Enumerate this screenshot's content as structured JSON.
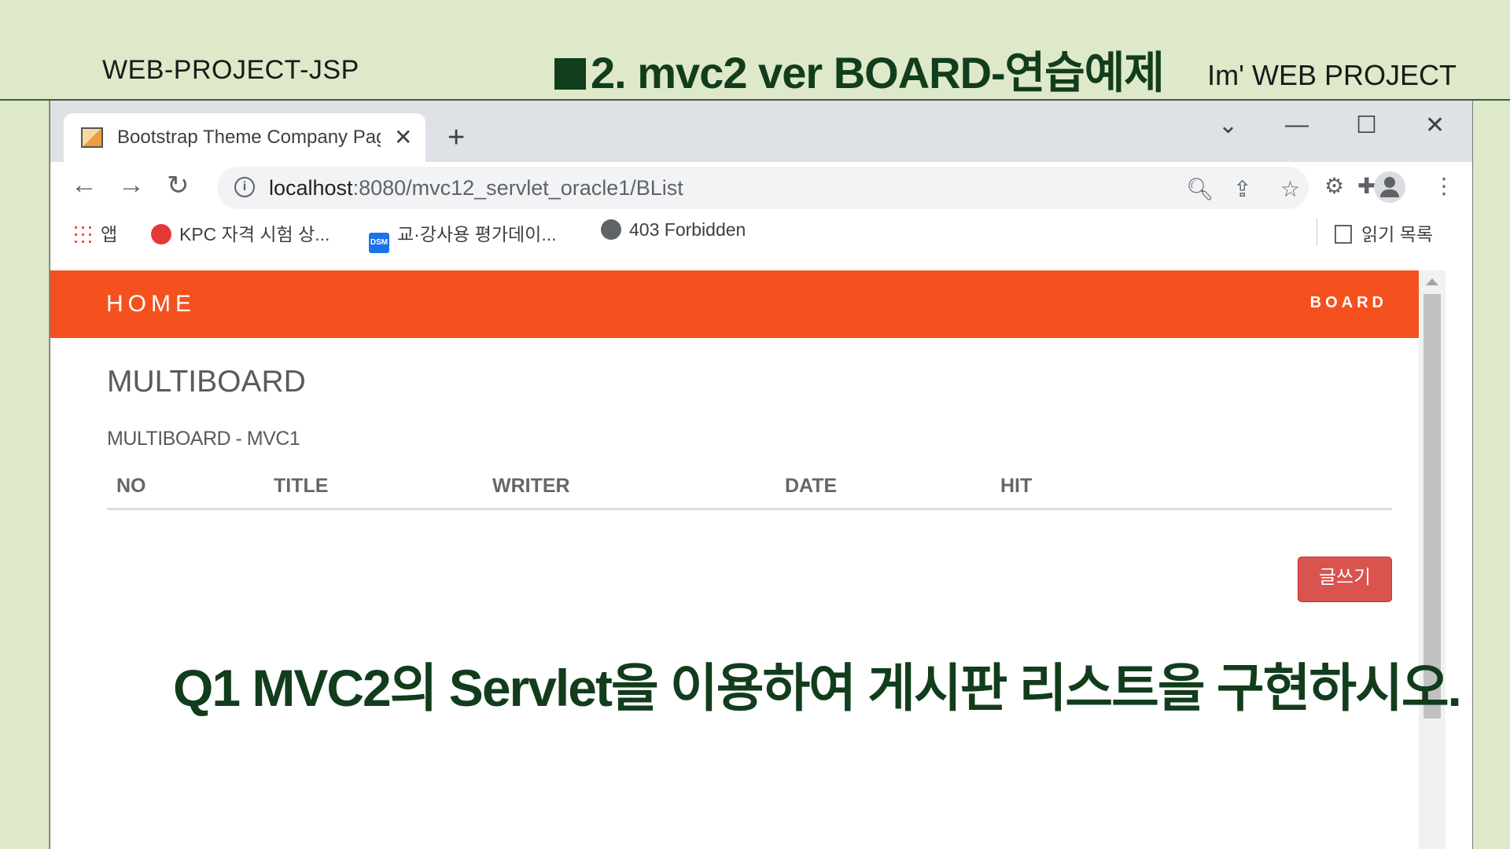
{
  "slide": {
    "left_label": "WEB-PROJECT-JSP",
    "title": "2. mvc2 ver  BOARD-연습예제",
    "right_label": "Im'  WEB PROJECT",
    "question": "Q1  MVC2의 Servlet을 이용하여 게시판 리스트을 구현하시오."
  },
  "browser": {
    "tab_title": "Bootstrap Theme Company Page",
    "tab_close": "✕",
    "new_tab": "+",
    "window_controls": [
      "⌄",
      "—",
      "☐",
      "✕"
    ],
    "nav": {
      "back": "←",
      "forward": "→",
      "reload": "↻"
    },
    "url_host": "localhost",
    "url_rest": ":8080/mvc12_servlet_oracle1/BList",
    "omnibox_icons": [
      "zoom-icon",
      "share-icon",
      "bookmark-star-icon"
    ],
    "bookmarks": [
      {
        "label": "앱",
        "icon": "apps-icon"
      },
      {
        "label": "KPC 자격 시험 상...",
        "icon": "kpc-icon"
      },
      {
        "label": "교·강사용 평가데이...",
        "icon": "dsm-icon",
        "icon_text": "DSM"
      },
      {
        "label": "403 Forbidden",
        "icon": "globe-icon"
      }
    ],
    "reading_list": "읽기 목록"
  },
  "page": {
    "nav_home": "HOME",
    "nav_board": "BOARD",
    "heading": "MULTIBOARD",
    "subheading": "MULTIBOARD - MVC1",
    "table_headers": [
      "NO",
      "TITLE",
      "WRITER",
      "DATE",
      "HIT"
    ],
    "table_rows": [],
    "write_button": "글쓰기"
  },
  "colors": {
    "slide_bg": "#dde9c8",
    "slide_title": "#123d1c",
    "navbar": "#f4511e",
    "write_button": "#d9534f"
  }
}
